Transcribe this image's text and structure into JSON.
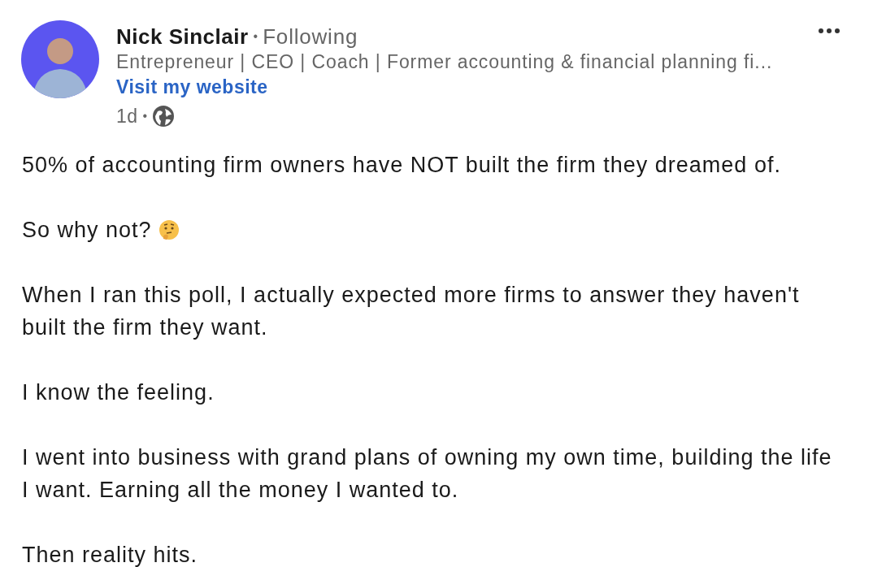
{
  "author": {
    "name": "Nick Sinclair",
    "connection": "Following",
    "headline": "Entrepreneur | CEO | Coach | Former accounting & financial planning fi...",
    "link": "Visit my website",
    "separator": "•",
    "time": "1d",
    "time_separator": "•",
    "public": true
  },
  "paragraphs": [
    {
      "text": "50% of accounting firm owners have NOT built the firm they dreamed of."
    },
    {
      "text": "So why not?",
      "emoji": true
    },
    {
      "text": "When I ran this poll, I actually expected more firms to answer they haven't built the firm they want."
    },
    {
      "text": "I know the feeling."
    },
    {
      "text": "I went into business with grand plans of owning my own time, building the life I want. Earning all the money I wanted to."
    },
    {
      "text": "Then reality hits."
    }
  ]
}
